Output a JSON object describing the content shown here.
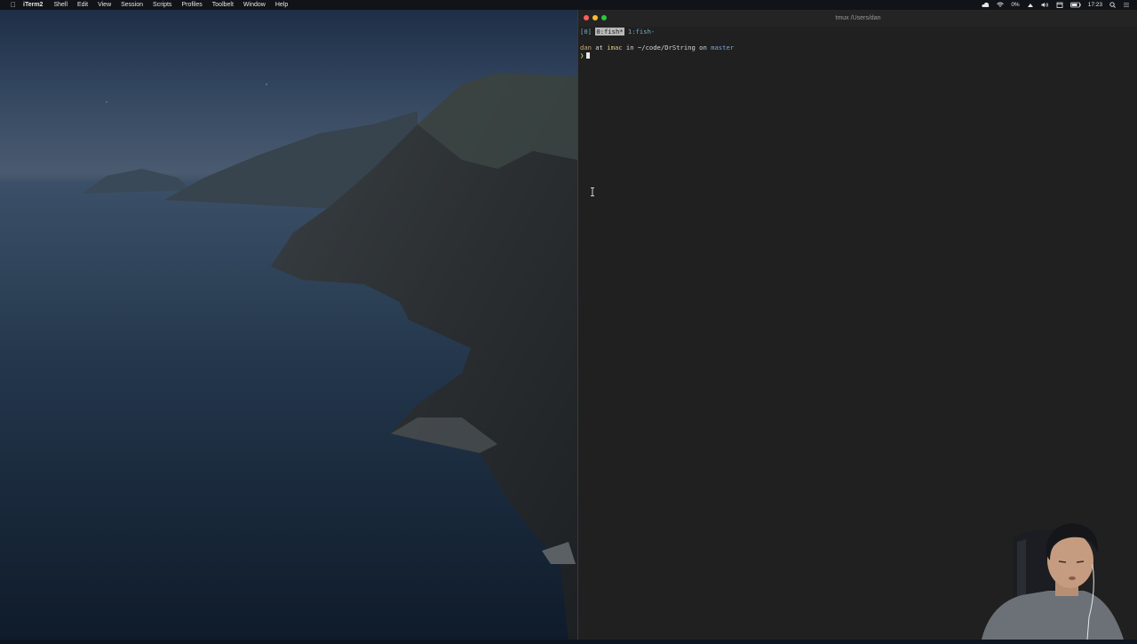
{
  "menubar": {
    "apple_glyph": "",
    "items": [
      "iTerm2",
      "Shell",
      "Edit",
      "View",
      "Session",
      "Scripts",
      "Profiles",
      "Toolbelt",
      "Window",
      "Help"
    ],
    "battery_label": "0%",
    "clock": "17:23"
  },
  "terminal": {
    "title": "tmux /Users/dan",
    "tmux_session": "[0] ",
    "tmux_window_active": "0:fish*",
    "tmux_window_other": " 1:fish-",
    "prompt": {
      "user": "dan",
      "at": " at ",
      "host": "imac",
      "in": " in ",
      "path": "~/code/DrString",
      "on": " on ",
      "branch": "master"
    },
    "input_chevron": "❯"
  },
  "colors": {
    "terminal_bg": "#202020",
    "menubar_bg": "#111318",
    "close": "#fe5f57",
    "minimize": "#febc2e",
    "maximize": "#28c840",
    "branch": "#7aa3d6",
    "chevron": "#9bd36b"
  },
  "icons": [
    "apple-icon",
    "cloud-icon",
    "wifi-icon",
    "battery-icon",
    "volume-icon",
    "airplay-icon",
    "calendar-icon",
    "spotlight-icon",
    "notification-center-icon",
    "ibeam-cursor-icon"
  ]
}
